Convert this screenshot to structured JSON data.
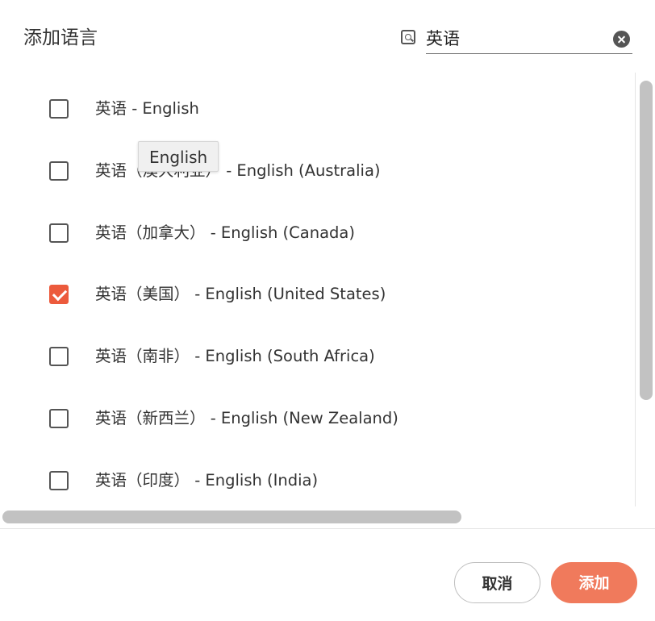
{
  "dialog": {
    "title": "添加语言",
    "search": {
      "value": "英语",
      "placeholder": ""
    },
    "tooltip": "English",
    "languages": [
      {
        "label": "英语 - English",
        "checked": false
      },
      {
        "label": "英语（澳大利亚） - English (Australia)",
        "checked": false
      },
      {
        "label": "英语（加拿大） - English (Canada)",
        "checked": false
      },
      {
        "label": "英语（美国） - English (United States)",
        "checked": true
      },
      {
        "label": "英语（南非） - English (South Africa)",
        "checked": false
      },
      {
        "label": "英语（新西兰） - English (New Zealand)",
        "checked": false
      },
      {
        "label": "英语（印度） - English (India)",
        "checked": false
      }
    ],
    "buttons": {
      "cancel": "取消",
      "add": "添加"
    },
    "colors": {
      "accent": "#ec5a3c",
      "add_button": "#f07a5c"
    }
  }
}
